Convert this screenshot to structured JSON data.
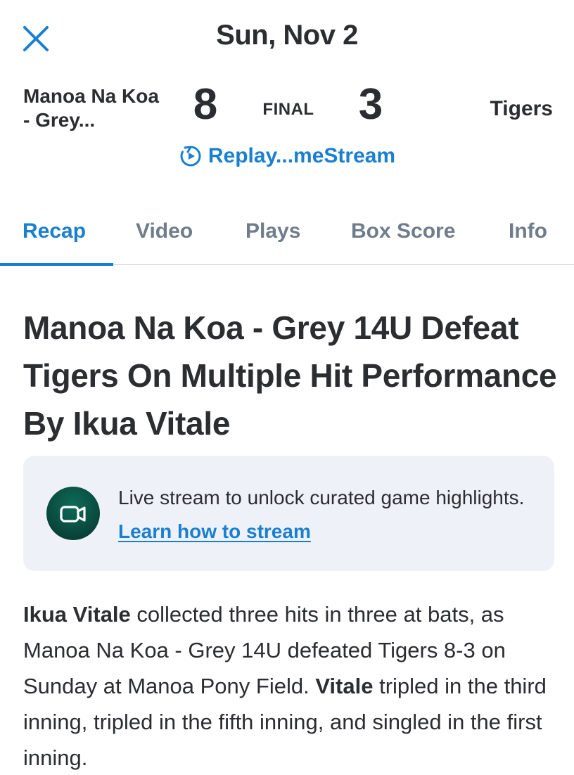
{
  "header": {
    "date": "Sun, Nov 2",
    "close_icon": "close-icon"
  },
  "scoreboard": {
    "home_team": "Manoa Na Koa - Grey...",
    "home_score": "8",
    "status": "FINAL",
    "away_score": "3",
    "away_team": "Tigers",
    "replay_label": "Replay...meStream",
    "replay_icon": "replay-icon"
  },
  "tabs": [
    {
      "label": "Recap",
      "active": true
    },
    {
      "label": "Video",
      "active": false
    },
    {
      "label": "Plays",
      "active": false
    },
    {
      "label": "Box Score",
      "active": false
    },
    {
      "label": "Info",
      "active": false
    }
  ],
  "article": {
    "headline": "Manoa Na Koa - Grey 14U Defeat Tigers On Multiple Hit Performance By Ikua Vitale",
    "stream_card": {
      "icon": "video-camera-icon",
      "text": "Live stream to unlock curated game highlights.",
      "link": "Learn how to stream"
    },
    "recap": {
      "p1_bold": "Ikua Vitale",
      "p1_text": " collected three hits in three at bats, as Manoa Na Koa - Grey 14U defeated Tigers 8-3 on Sunday at Manoa Pony Field. ",
      "p2_bold": "Vitale",
      "p2_text": " tripled in the third inning, tripled in the fifth inning, and singled in the first inning."
    }
  },
  "colors": {
    "accent": "#1a7fd0",
    "text": "#2b2d31",
    "tab_inactive": "#6f7c8b",
    "card_bg": "#eef2f8",
    "badge": "#0a4d40"
  }
}
